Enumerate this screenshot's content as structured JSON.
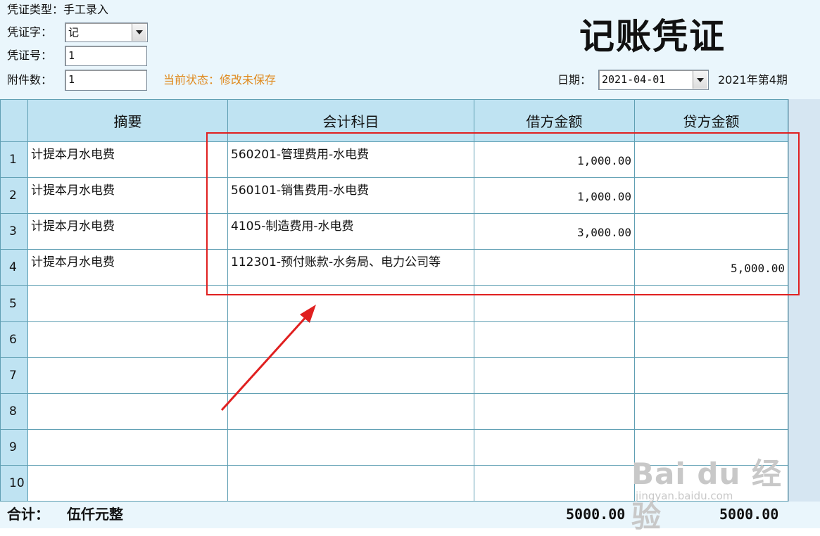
{
  "header": {
    "voucher_type_label": "凭证类型：",
    "voucher_type_value": "手工录入",
    "voucher_word_label": "凭证字：",
    "voucher_word_value": "记",
    "voucher_no_label": "凭证号：",
    "voucher_no_value": "1",
    "attachments_label": "附件数：",
    "attachments_value": "1",
    "status_label": "当前状态：",
    "status_value": "修改未保存",
    "title": "记账凭证",
    "date_label": "日期：",
    "date_value": "2021-04-01",
    "period_text": "2021年第4期"
  },
  "grid": {
    "columns": {
      "summary": "摘要",
      "account": "会计科目",
      "debit": "借方金额",
      "credit": "贷方金额"
    },
    "rows": [
      {
        "no": "1",
        "summary": "计提本月水电费",
        "account": "560201-管理费用-水电费",
        "debit": "1,000.00",
        "credit": ""
      },
      {
        "no": "2",
        "summary": "计提本月水电费",
        "account": "560101-销售费用-水电费",
        "debit": "1,000.00",
        "credit": ""
      },
      {
        "no": "3",
        "summary": "计提本月水电费",
        "account": "4105-制造费用-水电费",
        "debit": "3,000.00",
        "credit": ""
      },
      {
        "no": "4",
        "summary": "计提本月水电费",
        "account": "112301-预付账款-水务局、电力公司等",
        "debit": "",
        "credit": "5,000.00"
      },
      {
        "no": "5",
        "summary": "",
        "account": "",
        "debit": "",
        "credit": ""
      },
      {
        "no": "6",
        "summary": "",
        "account": "",
        "debit": "",
        "credit": ""
      },
      {
        "no": "7",
        "summary": "",
        "account": "",
        "debit": "",
        "credit": ""
      },
      {
        "no": "8",
        "summary": "",
        "account": "",
        "debit": "",
        "credit": ""
      },
      {
        "no": "9",
        "summary": "",
        "account": "",
        "debit": "",
        "credit": ""
      },
      {
        "no": "10",
        "summary": "",
        "account": "",
        "debit": "",
        "credit": ""
      }
    ]
  },
  "footer": {
    "total_label": "合计：",
    "total_words": "伍仟元整",
    "debit_total": "5000.00",
    "credit_total": "5000.00"
  },
  "watermark": {
    "brand": "Bai du 经验",
    "url": "jingyan.baidu.com"
  },
  "colors": {
    "background": "#eaf6fc",
    "header_fill": "#bfe3f2",
    "grid_line": "#5f9fb3",
    "status": "#e08a1e",
    "annotation": "#e02020"
  },
  "icons": {
    "dropdown": "chevron-down-icon"
  }
}
